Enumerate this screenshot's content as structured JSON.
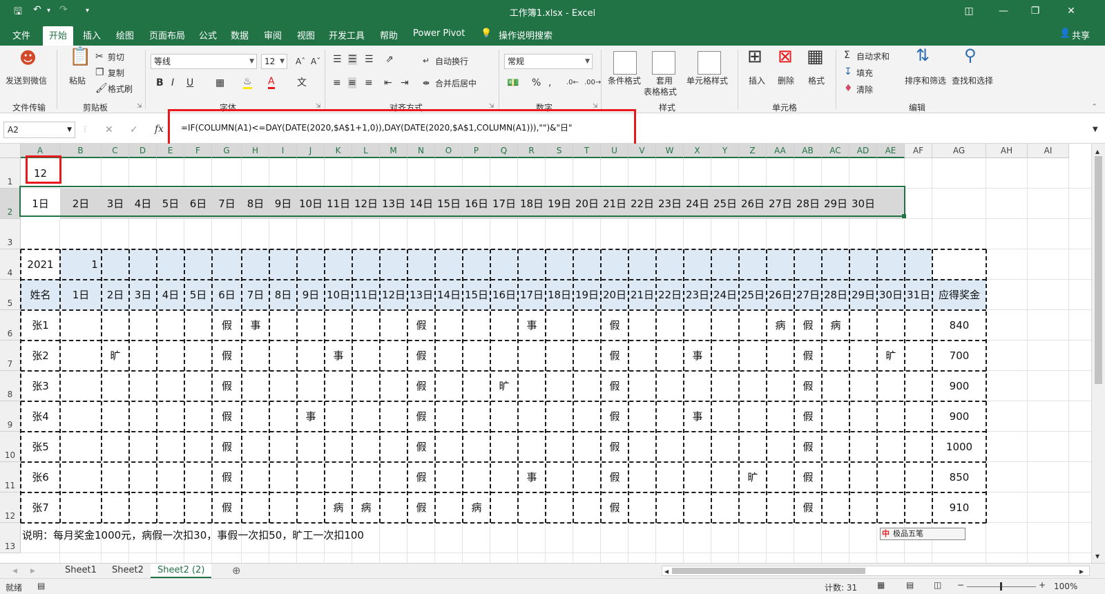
{
  "window": {
    "title": "工作簿1.xlsx  -  Excel",
    "share_label": "共享"
  },
  "tabs": [
    "文件",
    "开始",
    "插入",
    "绘图",
    "页面布局",
    "公式",
    "数据",
    "审阅",
    "视图",
    "开发工具",
    "帮助",
    "Power Pivot"
  ],
  "active_tab": "开始",
  "tell_me": "操作说明搜索",
  "ribbon": {
    "wechat": "发送到微信",
    "file_transfer": "文件传输",
    "paste": "粘贴",
    "cut": "剪切",
    "copy": "复制",
    "format_painter": "格式刷",
    "clipboard": "剪贴板",
    "font_name": "等线",
    "font_size": "12",
    "font": "字体",
    "bold": "B",
    "italic": "I",
    "underline": "U",
    "wrap_text": "自动换行",
    "merge_center": "合并后居中",
    "alignment": "对齐方式",
    "number_format": "常规",
    "number": "数字",
    "cond_format": "条件格式",
    "table_format_1": "套用",
    "table_format_2": "表格格式",
    "cell_styles": "单元格样式",
    "styles": "样式",
    "insert": "插入",
    "delete": "删除",
    "format": "格式",
    "cells": "单元格",
    "autosum": "自动求和",
    "fill": "填充",
    "clear": "清除",
    "sort_filter": "排序和筛选",
    "find_select": "查找和选择",
    "editing": "编辑"
  },
  "formula_bar": {
    "name_box": "A2",
    "fx": "fx",
    "formula": "=IF(COLUMN(A1)<=DAY(DATE(2020,$A$1+1,0)),DAY(DATE(2020,$A$1,COLUMN(A1))),\"\")&\"日\""
  },
  "columns": [
    "A",
    "B",
    "C",
    "D",
    "E",
    "F",
    "G",
    "H",
    "I",
    "J",
    "K",
    "L",
    "M",
    "N",
    "O",
    "P",
    "Q",
    "R",
    "S",
    "T",
    "U",
    "V",
    "W",
    "X",
    "Y",
    "Z",
    "AA",
    "AB",
    "AC",
    "AD",
    "AE",
    "AF",
    "AG",
    "AH",
    "AI"
  ],
  "rows": [
    "1",
    "2",
    "3",
    "4",
    "5",
    "6",
    "7",
    "8",
    "9",
    "10",
    "11",
    "12",
    "13"
  ],
  "sheet": {
    "a1": "12",
    "days": [
      "1日",
      "2日",
      "3日",
      "4日",
      "5日",
      "6日",
      "7日",
      "8日",
      "9日",
      "10日",
      "11日",
      "12日",
      "13日",
      "14日",
      "15日",
      "16日",
      "17日",
      "18日",
      "19日",
      "20日",
      "21日",
      "22日",
      "23日",
      "24日",
      "25日",
      "26日",
      "27日",
      "28日",
      "29日",
      "30日",
      "31日"
    ],
    "year": "2021",
    "month": "1",
    "name_header": "姓名",
    "bonus_header": "应得奖金",
    "employees": [
      {
        "name": "张1",
        "bonus": "840",
        "marks": {
          "6": "假",
          "7": "事",
          "13": "假",
          "17": "事",
          "20": "假",
          "26": "病",
          "27": "假",
          "28": "病"
        }
      },
      {
        "name": "张2",
        "bonus": "700",
        "marks": {
          "2": "旷",
          "6": "假",
          "10": "事",
          "13": "假",
          "20": "假",
          "23": "事",
          "27": "假",
          "30": "旷"
        }
      },
      {
        "name": "张3",
        "bonus": "900",
        "marks": {
          "6": "假",
          "13": "假",
          "16": "旷",
          "20": "假",
          "27": "假"
        }
      },
      {
        "name": "张4",
        "bonus": "900",
        "marks": {
          "6": "假",
          "9": "事",
          "13": "假",
          "20": "假",
          "23": "事",
          "27": "假"
        }
      },
      {
        "name": "张5",
        "bonus": "1000",
        "marks": {
          "6": "假",
          "13": "假",
          "20": "假",
          "27": "假"
        }
      },
      {
        "name": "张6",
        "bonus": "850",
        "marks": {
          "6": "假",
          "13": "假",
          "17": "事",
          "20": "假",
          "25": "旷",
          "27": "假"
        }
      },
      {
        "name": "张7",
        "bonus": "910",
        "marks": {
          "6": "假",
          "10": "病",
          "11": "病",
          "13": "假",
          "15": "病",
          "20": "假",
          "27": "假"
        }
      }
    ],
    "note": "说明：每月奖金1000元，病假一次扣30，事假一次扣50，旷工一次扣100"
  },
  "sheet_tabs": [
    "Sheet1",
    "Sheet2",
    "Sheet2 (2)"
  ],
  "active_sheet": "Sheet2 (2)",
  "status": {
    "ready": "就绪",
    "count": "计数: 31",
    "zoom": "100%"
  },
  "ime": "极品五笔",
  "colors": {
    "excel_green": "#217346",
    "highlight_red": "#e8181c",
    "header_fill": "#d8d8d8",
    "blue_fill": "#ddeaf6"
  }
}
